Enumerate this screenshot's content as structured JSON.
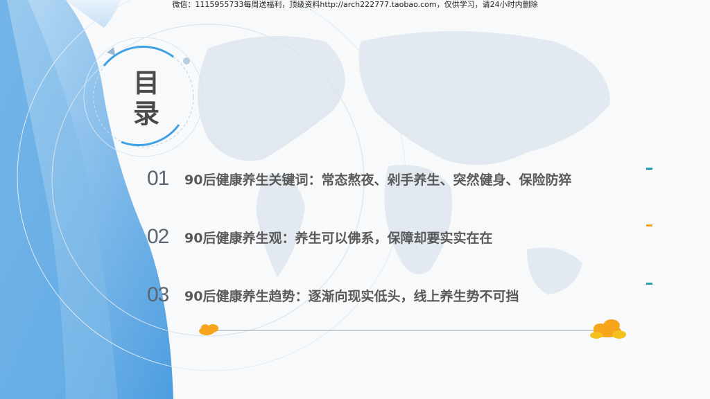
{
  "watermark": "微信：1115955733每周送福利，顶级资料http://arch222777.taobao.com，仅供学习，请24小时内删除",
  "title": [
    "目",
    "录"
  ],
  "items": [
    {
      "num": "01",
      "text": "90后健康养生关键词：常态熬夜、剁手养生、突然健身、保险防猝"
    },
    {
      "num": "02",
      "text": "90后健康养生观：养生可以佛系，保障却要实实在在"
    },
    {
      "num": "03",
      "text": "90后健康养生趋势：逐渐向现实低头，线上养生势不可挡"
    }
  ],
  "colors": {
    "accent_blue": "#3fa1e3",
    "accent_teal": "#1aa3a6",
    "accent_orange": "#f4a21a",
    "cloud_orange": "#f6a51c"
  }
}
